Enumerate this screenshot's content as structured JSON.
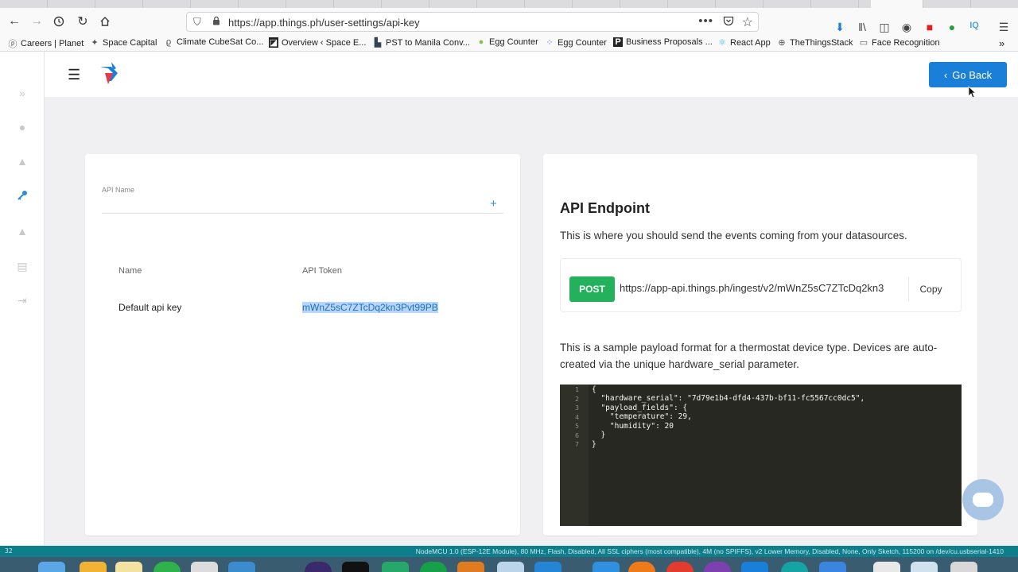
{
  "browser": {
    "url": "https://app.things.ph/user-settings/api-key",
    "bookmarks": [
      "Careers | Planet",
      "Space Capital",
      "Climate CubeSat Co...",
      "Overview ‹ Space E...",
      "PST to Manila Conv...",
      "Egg Counter",
      "Egg Counter",
      "Business Proposals ...",
      "React App",
      "TheThingsStack",
      "Face Recognition"
    ]
  },
  "header": {
    "go_back_label": "Go Back"
  },
  "api_keys": {
    "api_name_label": "API Name",
    "columns": [
      "Name",
      "API Token"
    ],
    "rows": [
      {
        "name": "Default api key",
        "token": "mWnZ5sC7ZTcDq2kn3Pvt99PB"
      }
    ]
  },
  "endpoint": {
    "title": "API Endpoint",
    "description": "This is where you should send the events coming from your datasources.",
    "method": "POST",
    "url": "https://app-api.things.ph/ingest/v2/mWnZ5sC7ZTcDq2kn3",
    "copy_label": "Copy",
    "sample_text": "This is a sample payload format for a thermostat device type. Devices are auto-created via the unique hardware_serial parameter.",
    "code_lines": [
      "{",
      "  \"hardware_serial\": \"7d79e1b4-dfd4-437b-bf11-fc5567cc0dc5\",",
      "  \"payload_fields\": {",
      "    \"temperature\": 29,",
      "    \"humidity\": 20",
      "  }",
      "}"
    ],
    "line_numbers": [
      "1",
      "2",
      "3",
      "4",
      "5",
      "6",
      "7"
    ]
  },
  "status_bar": {
    "left": "32",
    "right": "NodeMCU 1.0 (ESP-12E Module), 80 MHz, Flash, Disabled, All SSL ciphers (most compatible), 4M (no SPIFFS), v2 Lower Memory, Disabled, None, Only Sketch, 115200 on /dev/cu.usbserial-1410"
  },
  "colors": {
    "primary": "#1a7fd9",
    "post": "#23b15b",
    "code_bg": "#272822",
    "status_bar": "#0e7d8c"
  }
}
